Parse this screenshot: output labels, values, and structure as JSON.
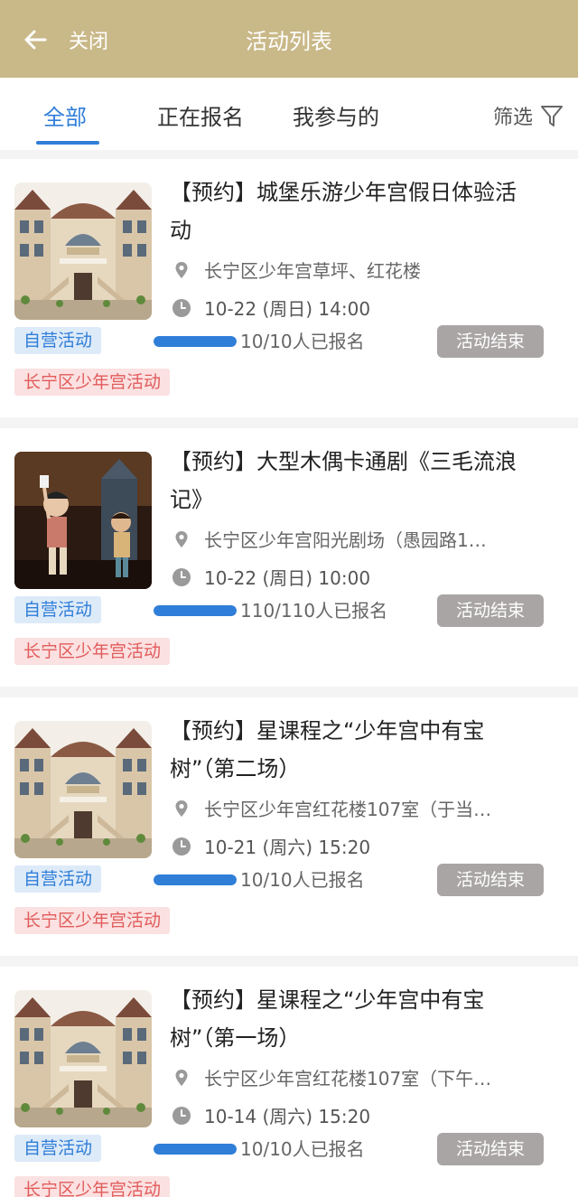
{
  "header": {
    "back_label": "关闭",
    "title": "活动列表"
  },
  "tabs": [
    {
      "label": "全部",
      "active": true
    },
    {
      "label": "正在报名",
      "active": false
    },
    {
      "label": "我参与的",
      "active": false
    }
  ],
  "filter_label": "筛选",
  "colors": {
    "header": "#c9b888",
    "accent": "#2f7ed8",
    "status_ended": "#a9a5a5",
    "tag_org": "#e25b5b"
  },
  "events": [
    {
      "image": "castle-building",
      "title": "【预约】城堡乐游少年宫假日体验活动",
      "location": "长宁区少年宫草坪、红花楼",
      "time": "10-22 (周日) 14:00",
      "tag_type": "自营活动",
      "org_tag": "长宁区少年宫活动",
      "registration_text": "10/10人已报名",
      "progress": 1.0,
      "status": "活动结束"
    },
    {
      "image": "puppet-stage",
      "title": "【预约】大型木偶卡通剧《三毛流浪记》",
      "location": "长宁区少年宫阳光剧场（愚园路1…",
      "time": "10-22 (周日) 10:00",
      "tag_type": "自营活动",
      "org_tag": "长宁区少年宫活动",
      "registration_text": "110/110人已报名",
      "progress": 1.0,
      "status": "活动结束"
    },
    {
      "image": "castle-building",
      "title": "【预约】星课程之“少年宫中有宝树”（第二场）",
      "location": "长宁区少年宫红花楼107室（于当…",
      "time": "10-21 (周六) 15:20",
      "tag_type": "自营活动",
      "org_tag": "长宁区少年宫活动",
      "registration_text": "10/10人已报名",
      "progress": 1.0,
      "status": "活动结束"
    },
    {
      "image": "castle-building",
      "title": "【预约】星课程之“少年宫中有宝树”（第一场）",
      "location": "长宁区少年宫红花楼107室（下午…",
      "time": "10-14 (周六) 15:20",
      "tag_type": "自营活动",
      "org_tag": "长宁区少年宫活动",
      "registration_text": "10/10人已报名",
      "progress": 1.0,
      "status": "活动结束"
    }
  ]
}
